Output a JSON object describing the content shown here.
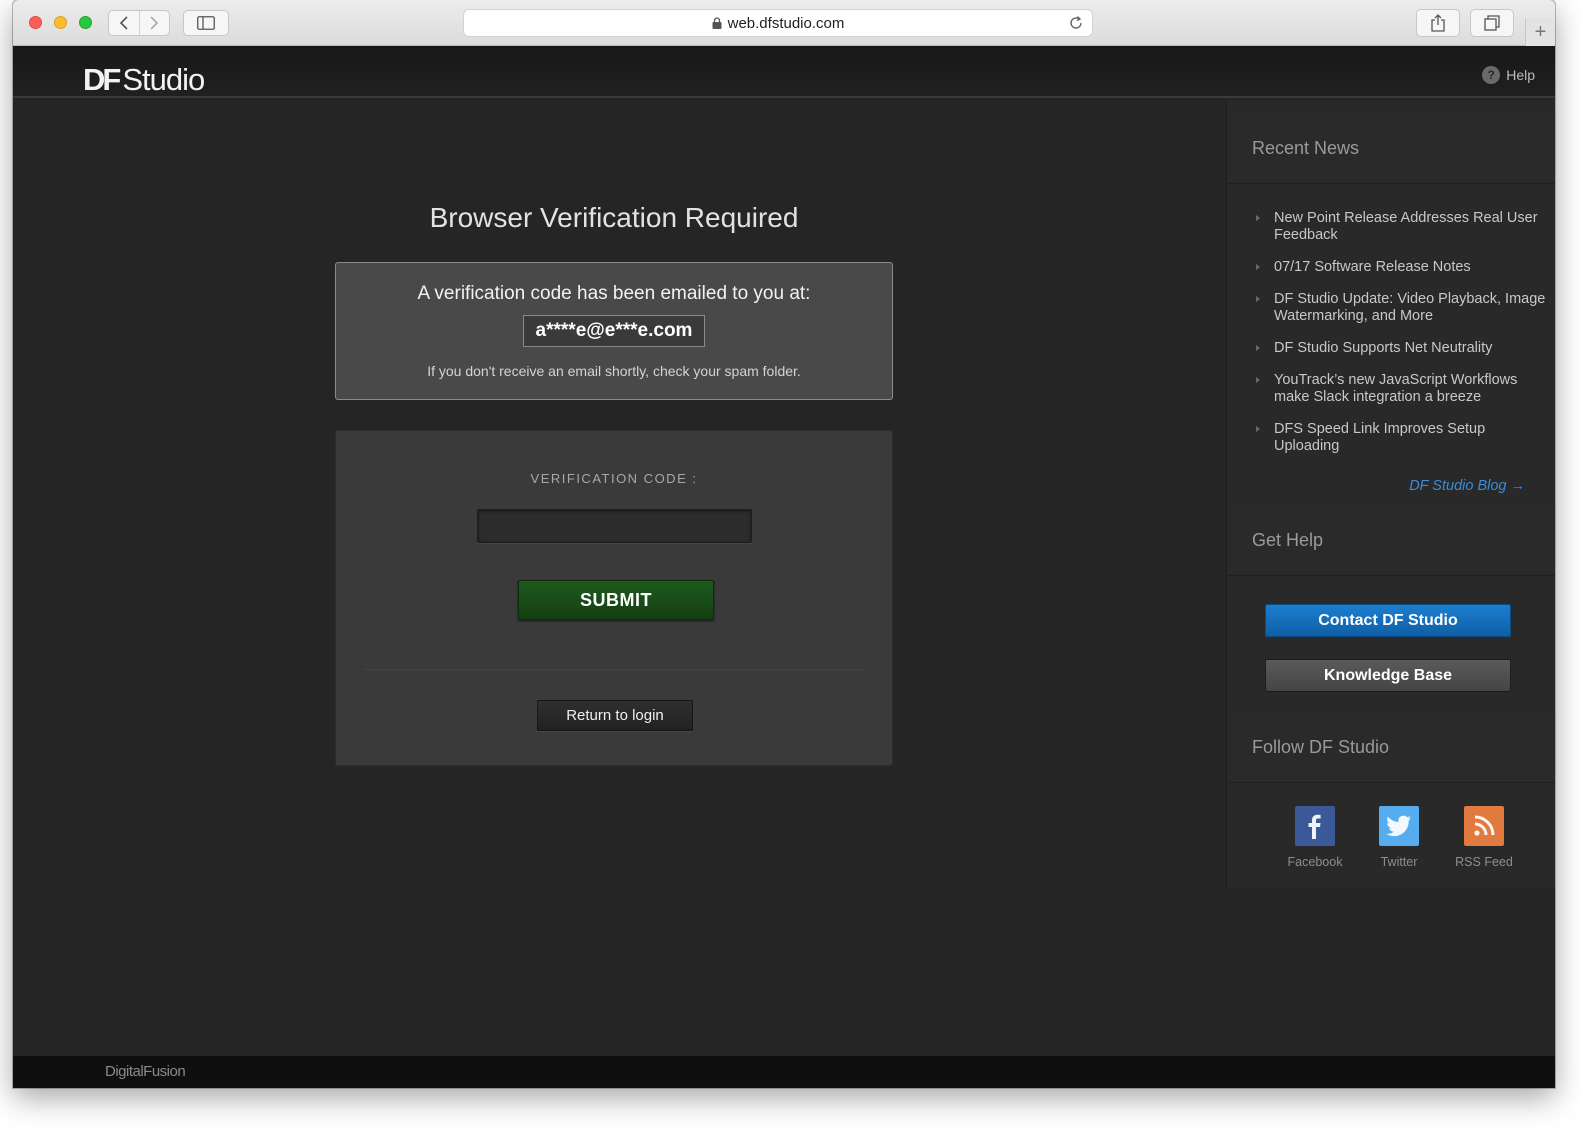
{
  "browser": {
    "url": "web.dfstudio.com"
  },
  "header": {
    "logo_df": "DF",
    "logo_studio": "Studio",
    "help_label": "Help"
  },
  "main": {
    "title": "Browser Verification Required",
    "notice_line": "A verification code has been emailed to you at:",
    "email": "a****e@e***e.com",
    "spam_note": "If you don't receive an email shortly, check your spam folder.",
    "code_label": "VERIFICATION CODE :",
    "code_value": "",
    "submit_label": "SUBMIT",
    "return_label": "Return to login"
  },
  "sidebar": {
    "news_heading": "Recent News",
    "news_items": [
      {
        "label": "New Point Release Addresses Real User Feedback"
      },
      {
        "label": "07/17 Software Release Notes"
      },
      {
        "label": "DF Studio Update: Video Playback, Image Watermarking, and More"
      },
      {
        "label": "DF Studio Supports Net Neutrality"
      },
      {
        "label": "YouTrack’s new JavaScript Workflows make Slack integration a breeze"
      },
      {
        "label": "DFS Speed Link Improves Setup Uploading"
      }
    ],
    "blog_link": "DF Studio Blog →",
    "help_heading": "Get Help",
    "contact_label": "Contact DF Studio",
    "kb_label": "Knowledge Base",
    "follow_heading": "Follow DF Studio",
    "social": [
      {
        "label": "Facebook",
        "icon": "facebook-icon",
        "color": "#3b5998"
      },
      {
        "label": "Twitter",
        "icon": "twitter-icon",
        "color": "#55acee"
      },
      {
        "label": "RSS Feed",
        "icon": "rss-icon",
        "color": "#e07a3f"
      }
    ]
  },
  "footer": {
    "logo": "DigitalFusion"
  },
  "colors": {
    "submit_green": "#1e5a1c",
    "contact_blue": "#1b7fd0",
    "link_blue": "#3d8bd4",
    "page_bg": "#252525"
  }
}
